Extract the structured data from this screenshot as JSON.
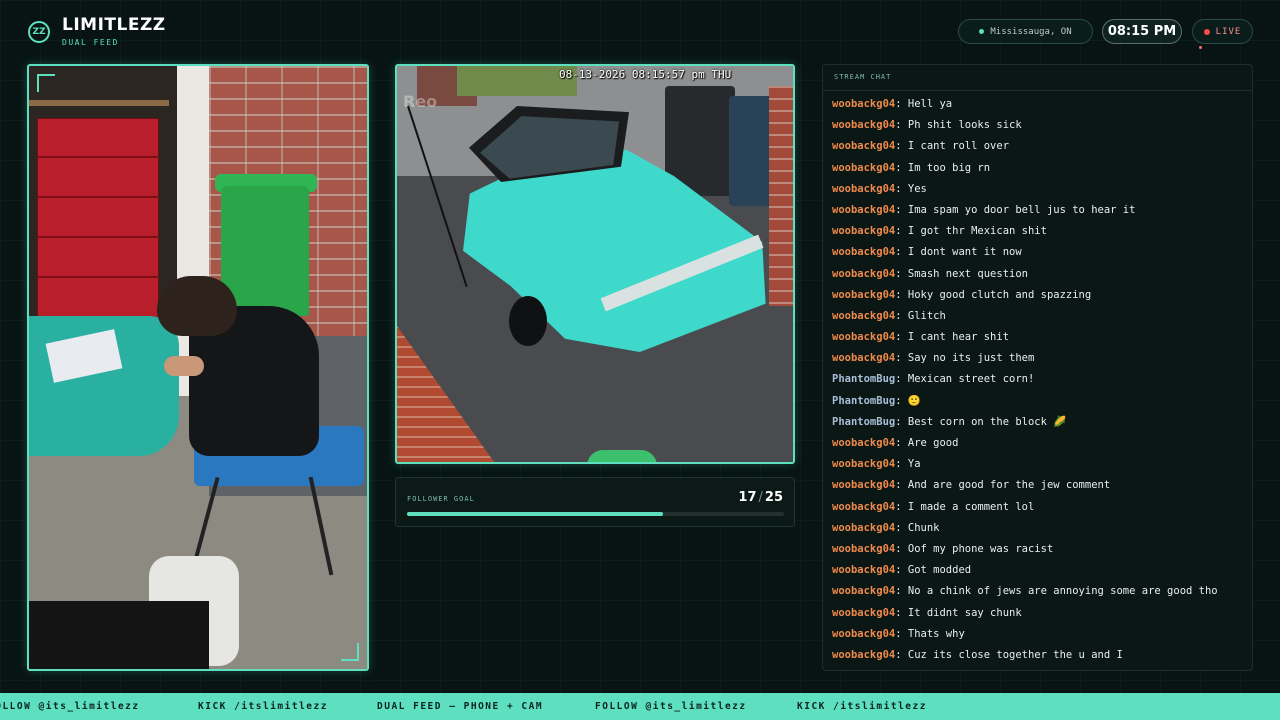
{
  "brand": {
    "badge": "ZZ",
    "name": "LIMITLEZZ",
    "subtitle": "DUAL FEED"
  },
  "header": {
    "location": "Mississauga, ON",
    "time": "08:15 PM",
    "live": "LIVE"
  },
  "camera": {
    "timestamp": "08-13-2026 08:15:57 pm THU",
    "watermark": "Reo"
  },
  "follower_goal": {
    "label": "FOLLOWER GOAL",
    "current": "17",
    "separator": "/",
    "target": "25",
    "progress": 0.68
  },
  "chat": {
    "title": "STREAM CHAT",
    "messages": [
      {
        "user": "woobackg04",
        "text": "Hell ya",
        "color": "orange"
      },
      {
        "user": "woobackg04",
        "text": "Ph shit looks sick",
        "color": "orange"
      },
      {
        "user": "woobackg04",
        "text": "I cant roll over",
        "color": "orange"
      },
      {
        "user": "woobackg04",
        "text": "Im too big rn",
        "color": "orange"
      },
      {
        "user": "woobackg04",
        "text": "Yes",
        "color": "orange"
      },
      {
        "user": "woobackg04",
        "text": "Ima spam yo door bell jus to hear it",
        "color": "orange"
      },
      {
        "user": "woobackg04",
        "text": "I got thr Mexican shit",
        "color": "orange"
      },
      {
        "user": "woobackg04",
        "text": "I dont want it now",
        "color": "orange"
      },
      {
        "user": "woobackg04",
        "text": "Smash next question",
        "color": "orange"
      },
      {
        "user": "woobackg04",
        "text": "Hoky good clutch and spazzing",
        "color": "orange"
      },
      {
        "user": "woobackg04",
        "text": "Glitch",
        "color": "orange"
      },
      {
        "user": "woobackg04",
        "text": "I cant hear shit",
        "color": "orange"
      },
      {
        "user": "woobackg04",
        "text": "Say no its just them",
        "color": "orange"
      },
      {
        "user": "PhantomBug",
        "text": "Mexican street corn!",
        "color": "blue"
      },
      {
        "user": "PhantomBug",
        "text": "🙂",
        "color": "blue"
      },
      {
        "user": "PhantomBug",
        "text": "Best corn on the block 🌽",
        "color": "blue"
      },
      {
        "user": "woobackg04",
        "text": "Are good",
        "color": "orange"
      },
      {
        "user": "woobackg04",
        "text": "Ya",
        "color": "orange"
      },
      {
        "user": "woobackg04",
        "text": "And are good for the jew comment",
        "color": "orange"
      },
      {
        "user": "woobackg04",
        "text": "I made a comment lol",
        "color": "orange"
      },
      {
        "user": "woobackg04",
        "text": "Chunk",
        "color": "orange"
      },
      {
        "user": "woobackg04",
        "text": "Oof my phone was racist",
        "color": "orange"
      },
      {
        "user": "woobackg04",
        "text": "Got modded",
        "color": "orange"
      },
      {
        "user": "woobackg04",
        "text": "No a chink of jews are annoying some are good tho",
        "color": "orange"
      },
      {
        "user": "woobackg04",
        "text": "It didnt say chunk",
        "color": "orange"
      },
      {
        "user": "woobackg04",
        "text": "Thats why",
        "color": "orange"
      },
      {
        "user": "woobackg04",
        "text": "Cuz its close together the u and I",
        "color": "orange"
      }
    ]
  },
  "ticker": {
    "items": [
      "FOLLOW @its_limitlezz",
      "KICK /itslimitlezz",
      "DUAL FEED — PHONE + CAM",
      "FOLLOW @its_limitlezz",
      "KICK /itslimitlezz"
    ]
  },
  "colors": {
    "accent": "#5ee0c0",
    "live": "#ff4848",
    "chat_user_orange": "#f08a4b",
    "chat_user_blue": "#a9bfd8"
  }
}
